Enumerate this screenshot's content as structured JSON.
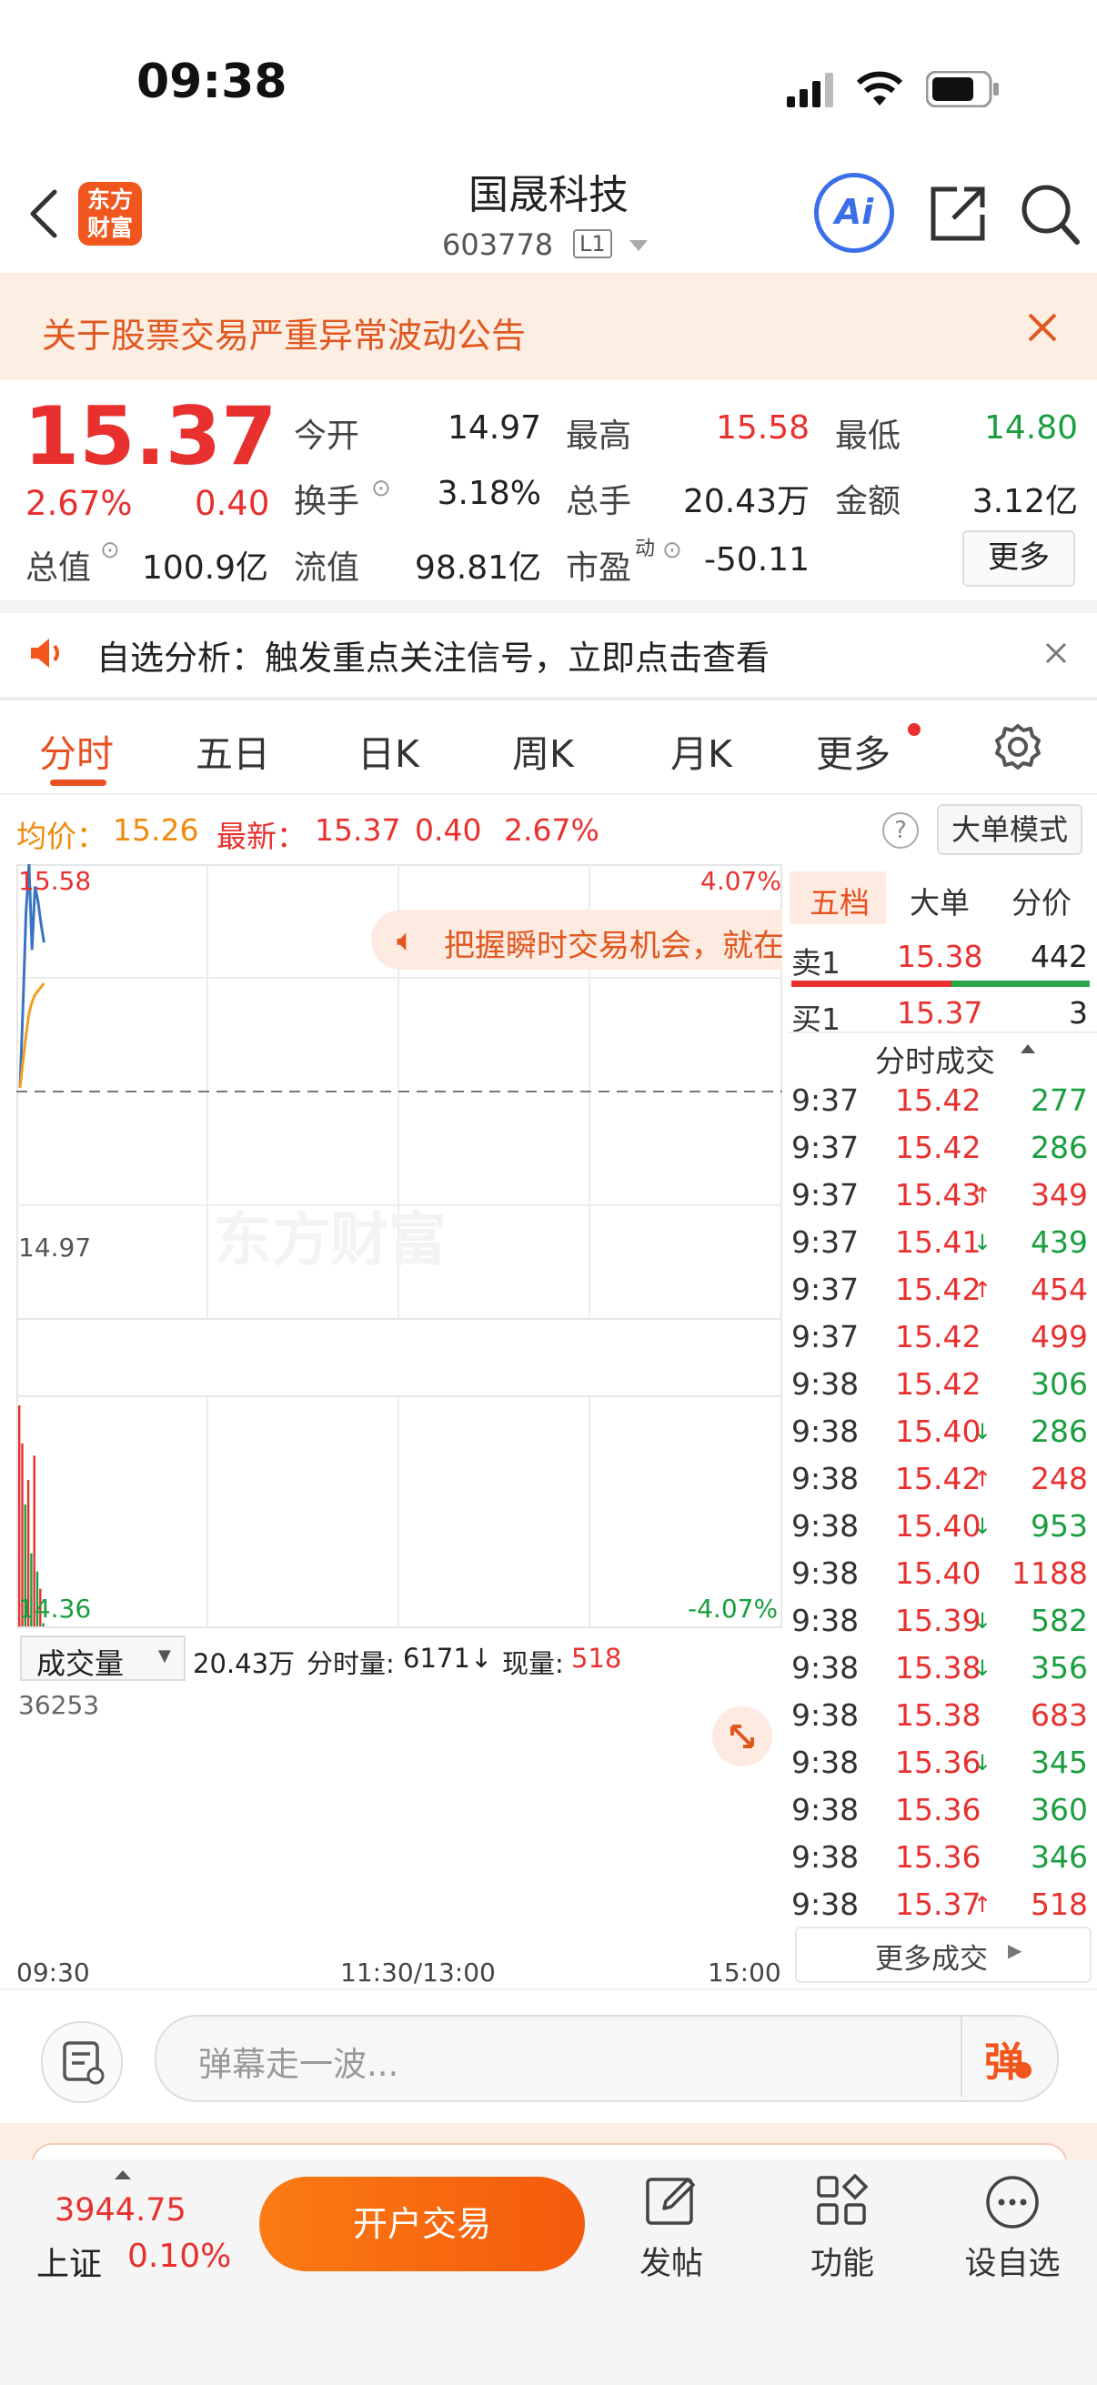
{
  "status_bar": {
    "time": "09:38"
  },
  "header": {
    "title": "国晟科技",
    "code": "603778",
    "level_badge": "L1",
    "logo_text_1": "东方",
    "logo_text_2": "财富",
    "ai_label": "Ai"
  },
  "notice": {
    "text": "关于股票交易严重异常波动公告"
  },
  "quote": {
    "price": "15.37",
    "change_pct": "2.67%",
    "change": "0.40",
    "open_label": "今开",
    "open": "14.97",
    "high_label": "最高",
    "high": "15.58",
    "low_label": "最低",
    "low": "14.80",
    "turnover_label": "换手",
    "turnover": "3.18%",
    "volume_label": "总手",
    "volume": "20.43万",
    "amount_label": "金额",
    "amount": "3.12亿",
    "mcap_label": "总值",
    "mcap": "100.9亿",
    "float_label": "流值",
    "float": "98.81亿",
    "pe_label": "市盈",
    "pe_sup": "动",
    "pe": "-50.11",
    "more_label": "更多"
  },
  "analysis": {
    "text": "自选分析：触发重点关注信号，立即点击查看"
  },
  "tabs": [
    "分时",
    "五日",
    "日K",
    "周K",
    "月K",
    "更多"
  ],
  "info_row": {
    "avg_label": "均价：",
    "avg": "15.26",
    "last_label": "最新：",
    "last": "15.37",
    "chg": "0.40",
    "pct": "2.67%",
    "big_order_label": "大单模式"
  },
  "chart": {
    "y_top": "15.58",
    "y_top_pct": "4.07%",
    "y_mid": "14.97",
    "y_bottom": "14.36",
    "y_bottom_pct": "-4.07%",
    "watermark": "东方财富",
    "promo": "把握瞬时交易机会，就在",
    "vol_selector": "成交量",
    "vol_total": "20.43万",
    "vol_minute_label": "分时量:",
    "vol_minute": "6171",
    "vol_now_label": "现量:",
    "vol_now": "518",
    "vol_max": "36253",
    "x_start": "09:30",
    "x_mid": "11:30/13:00",
    "x_end": "15:00"
  },
  "chart_data": {
    "type": "line",
    "series": [
      {
        "name": "最新",
        "x": [
          "9:30",
          "9:31",
          "9:32",
          "9:33",
          "9:34",
          "9:35",
          "9:36",
          "9:37",
          "9:38"
        ],
        "values": [
          14.98,
          15.2,
          15.45,
          15.58,
          15.35,
          15.52,
          15.48,
          15.42,
          15.37
        ]
      },
      {
        "name": "均价",
        "x": [
          "9:30",
          "9:31",
          "9:32",
          "9:33",
          "9:34",
          "9:35",
          "9:36",
          "9:37",
          "9:38"
        ],
        "values": [
          14.98,
          15.05,
          15.12,
          15.18,
          15.21,
          15.23,
          15.24,
          15.25,
          15.26
        ]
      }
    ],
    "volume": [
      36253,
      30000,
      20000,
      24000,
      12000,
      28000,
      9000,
      6171,
      518
    ],
    "ylim": [
      14.36,
      15.58
    ]
  },
  "orderbook": {
    "tabs": [
      "五档",
      "大单",
      "分价"
    ],
    "sell1_label": "卖1",
    "sell1_price": "15.38",
    "sell1_vol": "442",
    "buy1_label": "买1",
    "buy1_price": "15.37",
    "buy1_vol": "3",
    "trades_label": "分时成交",
    "more_trades": "更多成交"
  },
  "trades": [
    {
      "t": "9:37",
      "p": "15.42",
      "a": "",
      "v": "277",
      "vc": "green"
    },
    {
      "t": "9:37",
      "p": "15.42",
      "a": "",
      "v": "286",
      "vc": "green"
    },
    {
      "t": "9:37",
      "p": "15.43",
      "a": "↑",
      "v": "349",
      "vc": "red"
    },
    {
      "t": "9:37",
      "p": "15.41",
      "a": "↓",
      "v": "439",
      "vc": "green"
    },
    {
      "t": "9:37",
      "p": "15.42",
      "a": "↑",
      "v": "454",
      "vc": "red"
    },
    {
      "t": "9:37",
      "p": "15.42",
      "a": "",
      "v": "499",
      "vc": "red"
    },
    {
      "t": "9:38",
      "p": "15.42",
      "a": "",
      "v": "306",
      "vc": "green"
    },
    {
      "t": "9:38",
      "p": "15.40",
      "a": "↓",
      "v": "286",
      "vc": "green"
    },
    {
      "t": "9:38",
      "p": "15.42",
      "a": "↑",
      "v": "248",
      "vc": "red"
    },
    {
      "t": "9:38",
      "p": "15.40",
      "a": "↓",
      "v": "953",
      "vc": "green"
    },
    {
      "t": "9:38",
      "p": "15.40",
      "a": "",
      "v": "1188",
      "vc": "red"
    },
    {
      "t": "9:38",
      "p": "15.39",
      "a": "↓",
      "v": "582",
      "vc": "green"
    },
    {
      "t": "9:38",
      "p": "15.38",
      "a": "↓",
      "v": "356",
      "vc": "green"
    },
    {
      "t": "9:38",
      "p": "15.38",
      "a": "",
      "v": "683",
      "vc": "red"
    },
    {
      "t": "9:38",
      "p": "15.36",
      "a": "↓",
      "v": "345",
      "vc": "green"
    },
    {
      "t": "9:38",
      "p": "15.36",
      "a": "",
      "v": "360",
      "vc": "green"
    },
    {
      "t": "9:38",
      "p": "15.36",
      "a": "",
      "v": "346",
      "vc": "green"
    },
    {
      "t": "9:38",
      "p": "15.37",
      "a": "↑",
      "v": "518",
      "vc": "red"
    }
  ],
  "danmu": {
    "placeholder": "弹幕走一波...",
    "send_label": "弹"
  },
  "bottom": {
    "index_value": "3944.75",
    "index_name": "上证",
    "index_pct": "0.10%",
    "open_account": "开户交易",
    "post": "发帖",
    "functions": "功能",
    "add_watch": "设自选"
  },
  "colors": {
    "up": "#e8312f",
    "down": "#1a9e3f",
    "accent": "#f55a0c",
    "avg_line": "#f0a020",
    "price_line": "#3a74c0"
  }
}
